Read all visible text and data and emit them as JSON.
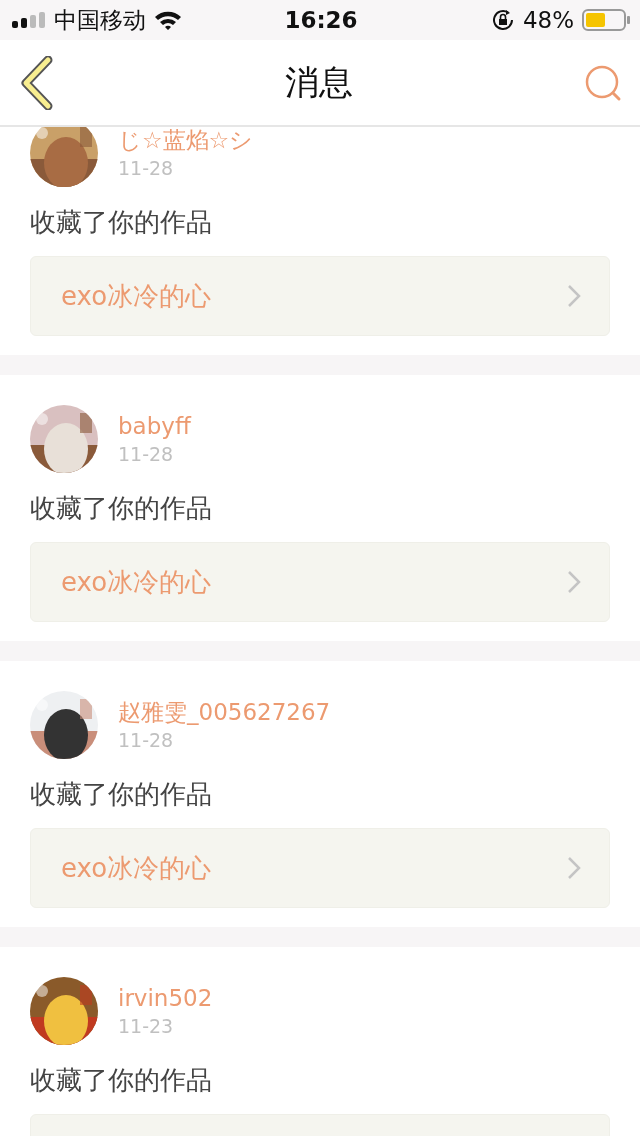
{
  "status_bar": {
    "carrier": "中国移动",
    "time": "16:26",
    "battery": "48%"
  },
  "header": {
    "title": "消息"
  },
  "messages": [
    {
      "user": "じ☆蓝焰☆シ",
      "date": "11-28",
      "action": "收藏了你的作品",
      "work": "exo冰冷的心"
    },
    {
      "user": "babyff",
      "date": "11-28",
      "action": "收藏了你的作品",
      "work": "exo冰冷的心"
    },
    {
      "user": "赵雅雯_005627267",
      "date": "11-28",
      "action": "收藏了你的作品",
      "work": "exo冰冷的心"
    },
    {
      "user": "irvin502",
      "date": "11-23",
      "action": "收藏了你的作品"
    }
  ]
}
